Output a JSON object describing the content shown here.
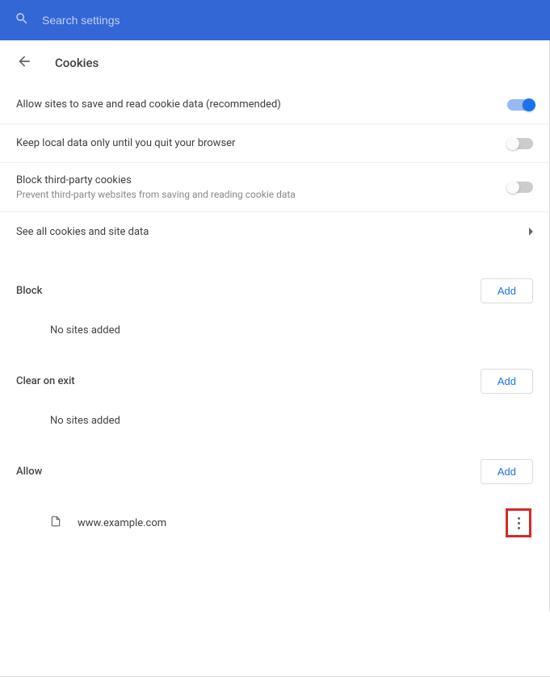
{
  "search": {
    "placeholder": "Search settings"
  },
  "page_title": "Cookies",
  "settings": {
    "allow_cookies": {
      "label": "Allow sites to save and read cookie data (recommended)",
      "enabled": true
    },
    "keep_local": {
      "label": "Keep local data only until you quit your browser",
      "enabled": false
    },
    "block_third": {
      "label": "Block third-party cookies",
      "sub": "Prevent third-party websites from saving and reading cookie data",
      "enabled": false
    },
    "see_all": {
      "label": "See all cookies and site data"
    }
  },
  "sections": {
    "block": {
      "title": "Block",
      "add_label": "Add",
      "empty": "No sites added"
    },
    "clear": {
      "title": "Clear on exit",
      "add_label": "Add",
      "empty": "No sites added"
    },
    "allow": {
      "title": "Allow",
      "add_label": "Add",
      "site": "www.example.com"
    }
  }
}
